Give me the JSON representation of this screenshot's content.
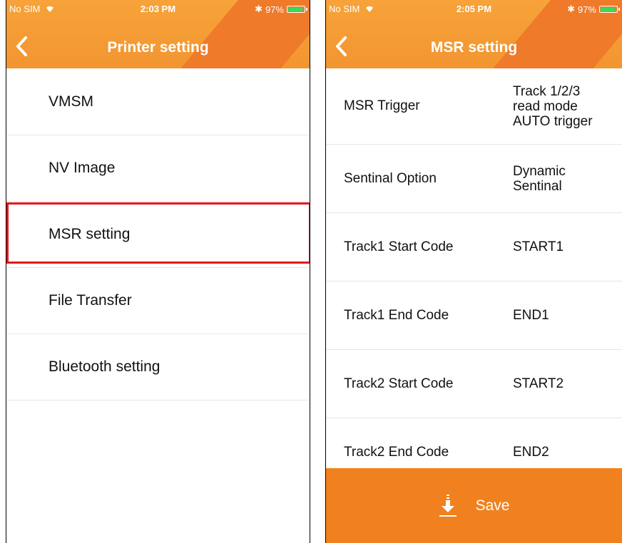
{
  "left": {
    "status": {
      "carrier": "No SIM",
      "time": "2:03 PM",
      "battery": "97%"
    },
    "title": "Printer setting",
    "items": [
      {
        "label": "VMSM"
      },
      {
        "label": "NV Image"
      },
      {
        "label": "MSR setting"
      },
      {
        "label": "File Transfer"
      },
      {
        "label": "Bluetooth setting"
      }
    ],
    "highlighted_item": "MSR setting"
  },
  "right": {
    "status": {
      "carrier": "No SIM",
      "time": "2:05 PM",
      "battery": "97%"
    },
    "title": "MSR setting",
    "rows": [
      {
        "label": "MSR Trigger",
        "value": "Track 1/2/3 read mode AUTO trigger"
      },
      {
        "label": "Sentinal Option",
        "value": "Dynamic Sentinal"
      },
      {
        "label": "Track1 Start Code",
        "value": "START1"
      },
      {
        "label": "Track1 End Code",
        "value": "END1"
      },
      {
        "label": "Track2 Start Code",
        "value": "START2"
      },
      {
        "label": "Track2 End Code",
        "value": "END2"
      }
    ],
    "save_label": "Save"
  },
  "colors": {
    "header": "#f29530",
    "save_bar": "#f1811f",
    "highlight": "#e3141c",
    "battery": "#3bd85b"
  }
}
